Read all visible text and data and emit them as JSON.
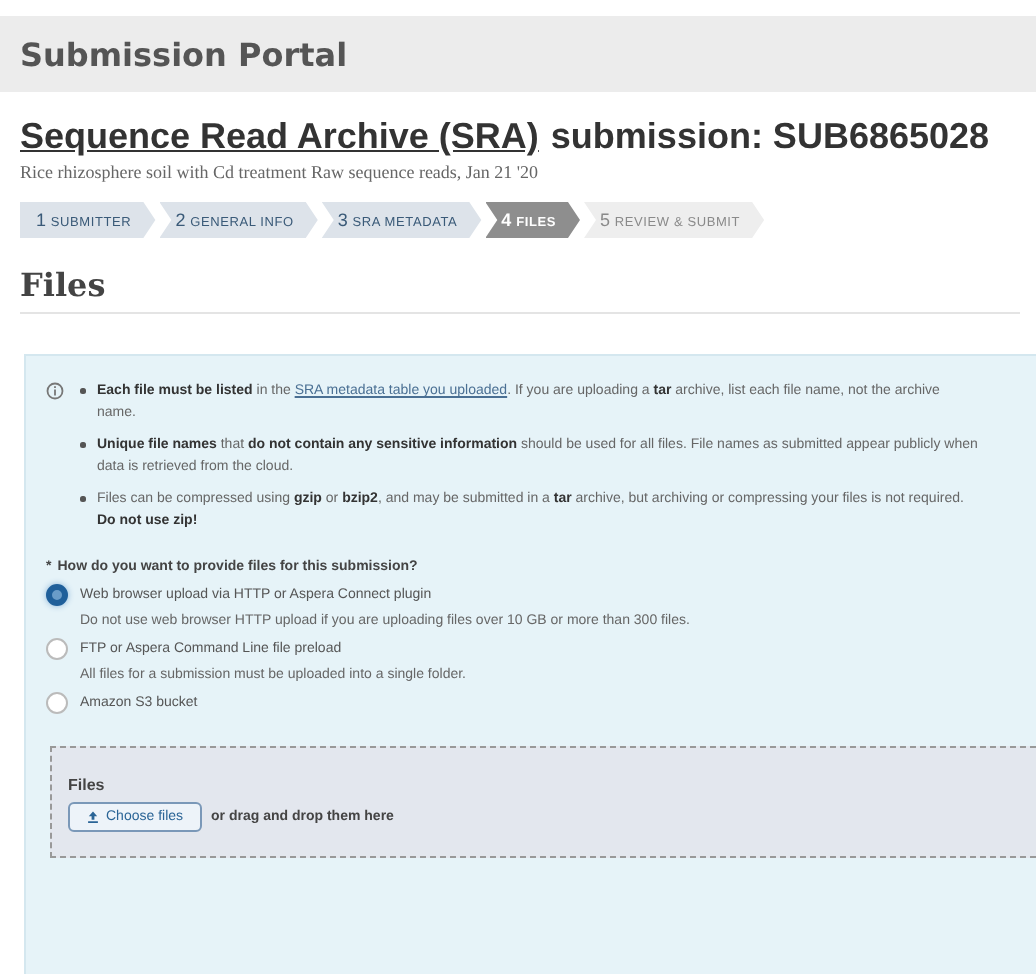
{
  "header": {
    "title": "Submission Portal"
  },
  "page_title": {
    "link": "Sequence Read Archive (SRA)",
    "text": "submission: SUB6865028"
  },
  "subtitle": "Rice rhizosphere soil with Cd treatment Raw sequence reads, Jan 21 '20",
  "steps": [
    {
      "number": "1",
      "label": "SUBMITTER",
      "selected": false,
      "disabled": false
    },
    {
      "number": "2",
      "label": "GENERAL INFO",
      "selected": false,
      "disabled": false
    },
    {
      "number": "3",
      "label": "SRA METADATA",
      "selected": false,
      "disabled": false
    },
    {
      "number": "4",
      "label": "FILES",
      "selected": true,
      "disabled": false
    },
    {
      "number": "5",
      "label": "REVIEW & SUBMIT",
      "selected": false,
      "disabled": true
    }
  ],
  "section_title": "Files",
  "notes": [
    {
      "text": "**Each file must be listed** in the ",
      "link": "SRA metadata table you uploaded",
      "text_after": ". If you are uploading a **tar** archive, list each file name, not the archive name."
    },
    {
      "text": "**Unique file names** that **do not contain any sensitive information** should be used for all files. File names as submitted appear publicly when data is retrieved from the cloud."
    },
    {
      "text": "Files can be compressed using **gzip** or **bzip2**, and may be submitted in a **tar** archive, but archiving or compressing your files is not required. **Do not use zip!**"
    }
  ],
  "question": {
    "marker": "*",
    "text": "How do you want to provide files for this submission?"
  },
  "options": [
    {
      "label": "Web browser upload via HTTP or Aspera Connect plugin",
      "description": "Do not use web browser HTTP upload if you are uploading files over 10 GB or more than 300 files.",
      "selected": true
    },
    {
      "label": "FTP or Aspera Command Line file preload",
      "description": "All files for a submission must be uploaded into a single folder.",
      "selected": false
    },
    {
      "label": "Amazon S3 bucket",
      "selected": false
    }
  ],
  "upload": {
    "label": "Files",
    "button": "Choose files",
    "hint": "or drag and drop them here"
  }
}
